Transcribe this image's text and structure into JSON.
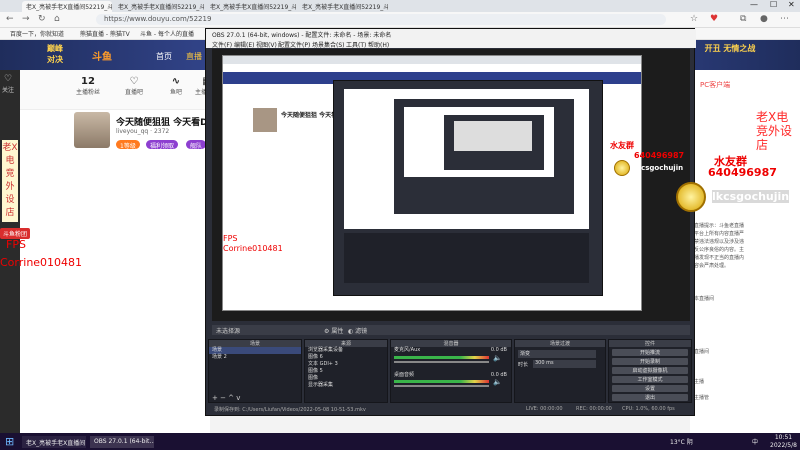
{
  "browser": {
    "tabs": [
      "老X_亮被手老X直播间52219_斗",
      "老X_亮被手老X直播间52219_斗",
      "老X_亮被手老X直播间52219_斗",
      "老X_亮被手老X直播间52219_斗"
    ],
    "url": "https://www.douyu.com/52219",
    "bookmarks": [
      "百度一下，你就知道",
      "熊猫直播 - 熊猫TV",
      "斗鱼 - 每个人的直播",
      "电脑游戏直播",
      "斗鱼"
    ]
  },
  "site": {
    "logo": "斗鱼",
    "nav": [
      "首页",
      "直播",
      "分类"
    ],
    "banner_right": "开丑 无情之战",
    "stats": [
      {
        "value": "12",
        "label": "主播粉丝"
      },
      {
        "value": "",
        "label": "直播吧"
      },
      {
        "value": "",
        "label": "鱼吧"
      },
      {
        "value": "",
        "label": "主播动态"
      }
    ],
    "room_title": "今天随便狙狙 今天看DEMO",
    "room_author": "liveyou_qq",
    "room_count": "2372",
    "room_tags": [
      "1等级",
      "福利领取",
      "舰队"
    ],
    "sidebar_label": "关注",
    "vertical_title": "老X电竞外设店",
    "follow_badge": "斗鱼粉团",
    "pc_client": "PC客户端",
    "announcement": "直播提示：斗鱼老直播平台上所有内容直播严禁违法违规以及涉及违反公序良俗的内容。主播发现不正当的直播内容会严肃处理。",
    "sidebar_links": [
      "本直播间",
      "直播间",
      "主播",
      "主播管",
      "直播间",
      "直播间",
      "直播间"
    ]
  },
  "overlay": {
    "fps": "FPS",
    "name": "Corrine010481",
    "fan_title": "水友群",
    "fan_number": "640496987",
    "watermark_name": "lkcsgochujin",
    "vertical_red": "老X电竞外设店"
  },
  "obs": {
    "title": "OBS 27.0.1 (64-bit, windows) - 配置文件: 未命名 - 场景: 未命名",
    "menu": [
      "文件(F)",
      "编辑(E)",
      "视图(V)",
      "配置文件(P)",
      "场景集合(S)",
      "工具(T)",
      "帮助(H)"
    ],
    "tabs": [
      "未选择源",
      "属性",
      "滤镜"
    ],
    "docks": {
      "scenes": {
        "title": "场景",
        "items": [
          "场景",
          "场景 2"
        ]
      },
      "sources": {
        "title": "来源",
        "items": [
          "浏览器采集设备",
          "图像 6",
          "文本 GDI+ 3",
          "图像 5",
          "图像",
          "显示器采集"
        ]
      },
      "mixer": {
        "title": "混音器",
        "channels": [
          {
            "name": "麦克风/Aux",
            "db": "0.0 dB"
          },
          {
            "name": "桌面音频",
            "db": "0.0 dB"
          }
        ]
      },
      "transitions": {
        "title": "场景过渡",
        "type": "渐变",
        "duration_label": "时长",
        "duration": "300 ms"
      },
      "controls": {
        "title": "控件",
        "buttons": [
          "开始推流",
          "开始录制",
          "启动虚拟摄像机",
          "工作室模式",
          "设置",
          "退出"
        ]
      }
    },
    "status": {
      "path": "录制保存到: C:/Users/Liufan/Videos/2022-05-08 10-51-53.mkv",
      "live": "LIVE: 00:00:00",
      "rec": "REC: 00:00:00",
      "cpu": "CPU: 1.0%, 60.00 fps"
    }
  },
  "taskbar": {
    "items": [
      "老X_亮被手老X直播间",
      "OBS 27.0.1 (64-bit..."
    ],
    "weather": "13°C 阴",
    "time": "10:51",
    "date": "2022/5/8",
    "lang": "中"
  },
  "colors": {
    "accent": "#3b4fa0",
    "obs_bg": "#2b2e38",
    "overlay_red": "#e00000",
    "taskbar": "#1a1032"
  }
}
